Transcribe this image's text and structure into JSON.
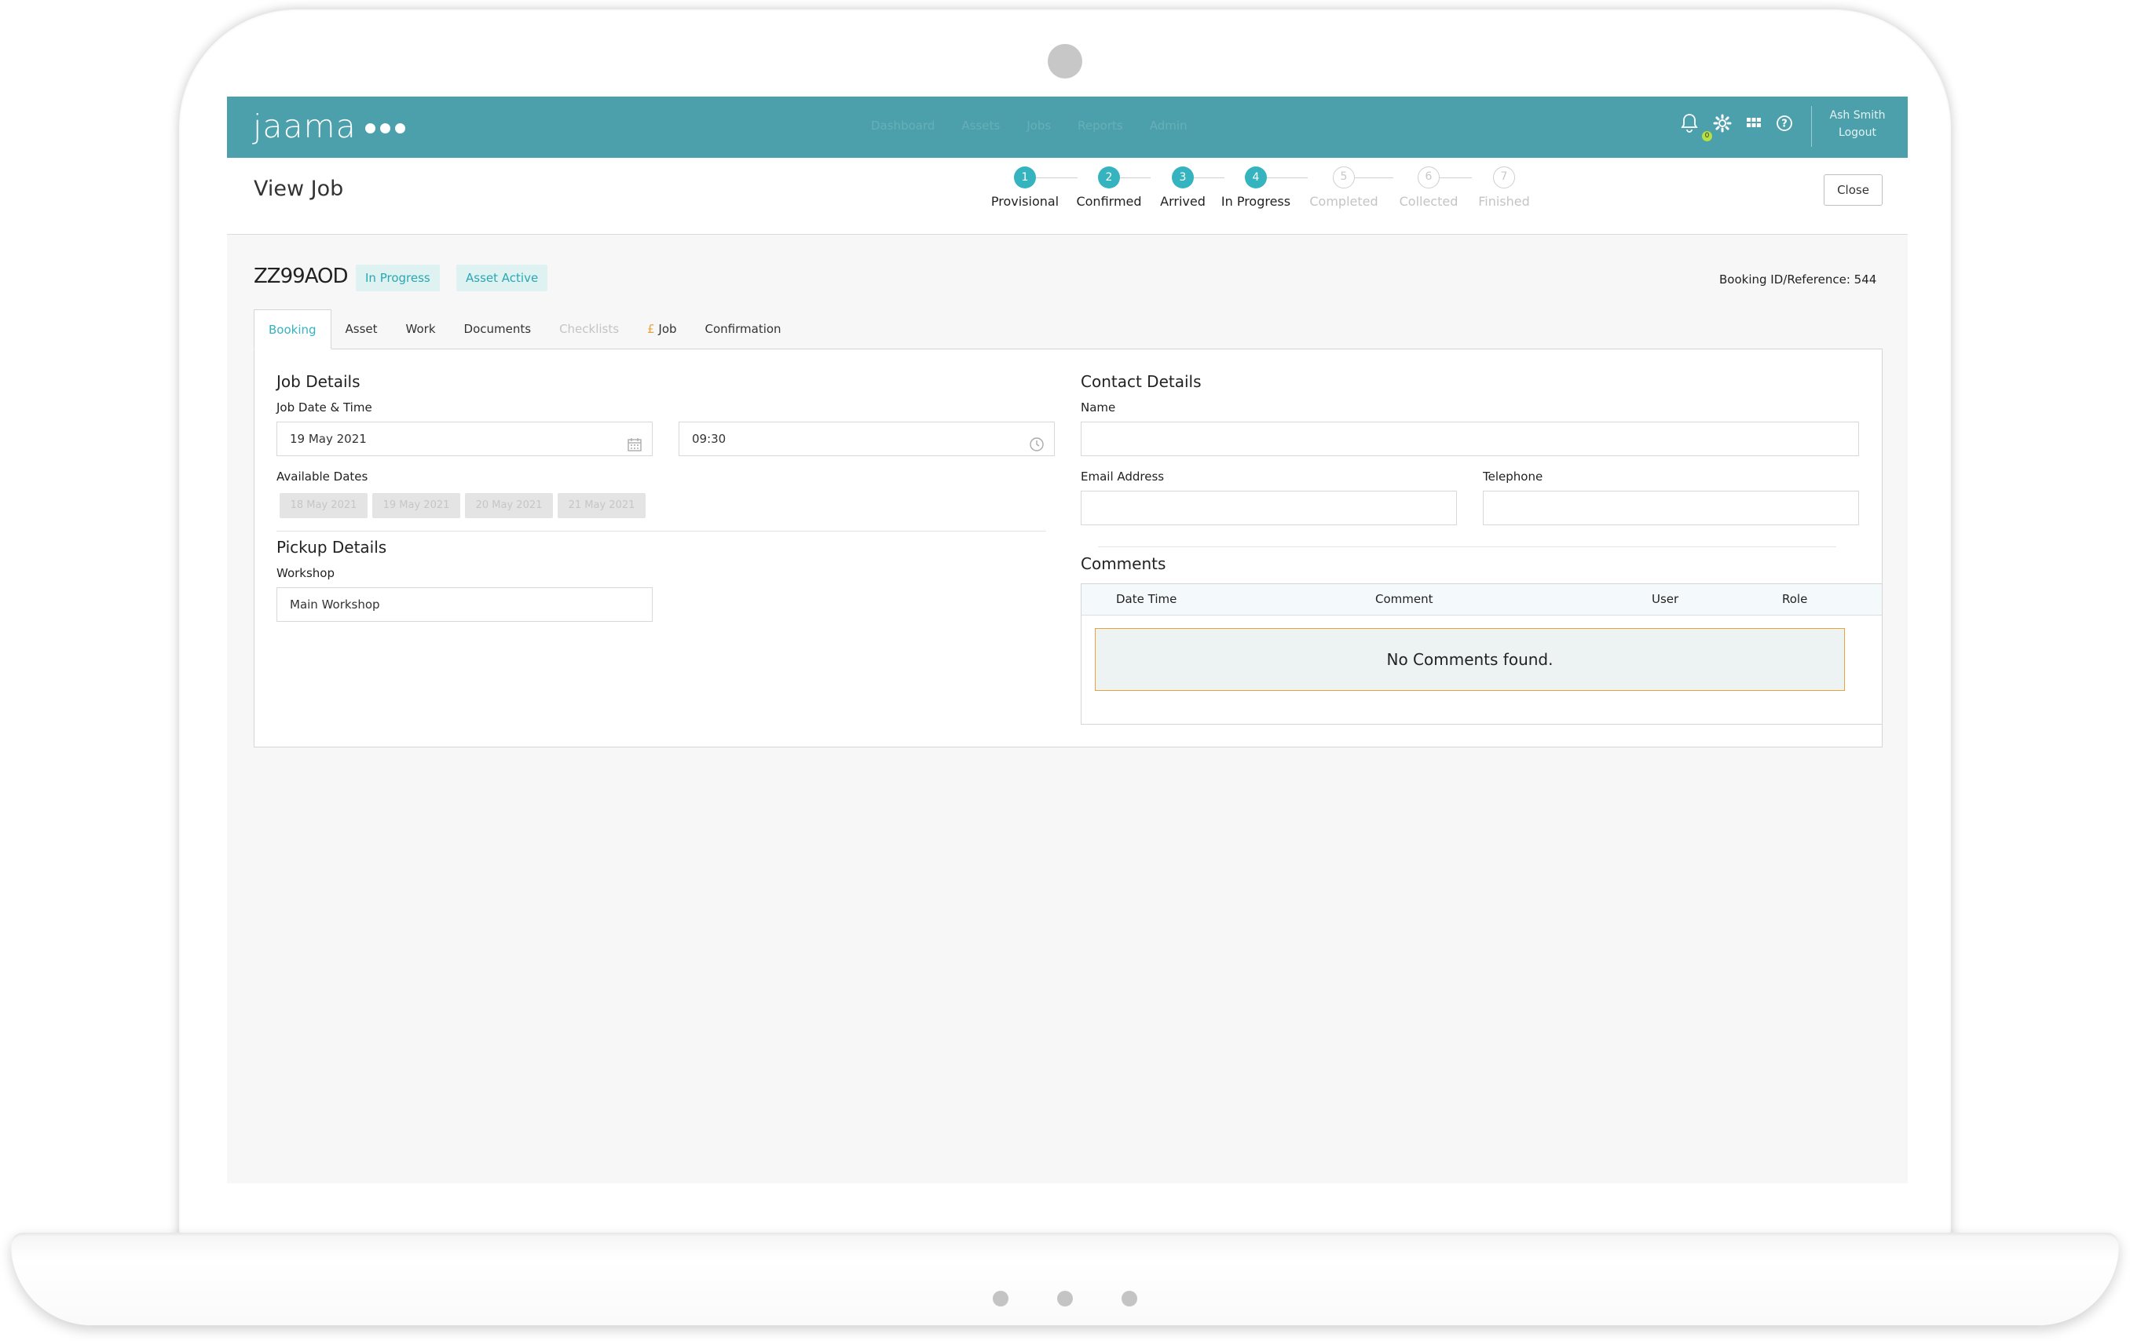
{
  "app": {
    "logo": "jaama",
    "nav_items": [
      "Dashboard",
      "Assets",
      "Jobs",
      "Reports",
      "Admin"
    ],
    "notifications_count": "0",
    "user_name": "Ash Smith",
    "logout_label": "Logout"
  },
  "page": {
    "title": "View Job",
    "close_label": "Close"
  },
  "stepper": {
    "steps": [
      {
        "number": "1",
        "label": "Provisional",
        "state": "complete"
      },
      {
        "number": "2",
        "label": "Confirmed",
        "state": "complete"
      },
      {
        "number": "3",
        "label": "Arrived",
        "state": "complete"
      },
      {
        "number": "4",
        "label": "In Progress",
        "state": "current"
      },
      {
        "number": "5",
        "label": "Completed",
        "state": "pending"
      },
      {
        "number": "6",
        "label": "Collected",
        "state": "pending"
      },
      {
        "number": "7",
        "label": "Finished",
        "state": "pending"
      }
    ]
  },
  "job": {
    "registration": "ZZ99AOD",
    "status_badge": "In Progress",
    "asset_badge": "Asset Active",
    "booking_ref": "Booking ID/Reference: 544"
  },
  "tabs": {
    "booking": "Booking",
    "asset": "Asset",
    "work": "Work",
    "documents": "Documents",
    "checklists": "Checklists",
    "job_pound": "£",
    "job": "Job",
    "confirmation": "Confirmation"
  },
  "job_details": {
    "title": "Job Details",
    "date_time_label": "Job Date & Time",
    "date_value": "19 May 2021",
    "time_value": "09:30",
    "available_dates_label": "Available Dates",
    "available_dates": [
      "18 May 2021",
      "19 May 2021",
      "20 May 2021",
      "21 May 2021"
    ]
  },
  "pickup": {
    "title": "Pickup Details",
    "workshop_label": "Workshop",
    "workshop_value": "Main Workshop"
  },
  "contact": {
    "title": "Contact Details",
    "name_label": "Name",
    "name_value": "",
    "email_label": "Email Address",
    "email_value": "",
    "telephone_label": "Telephone",
    "telephone_value": ""
  },
  "comments": {
    "title": "Comments",
    "columns": [
      "Date Time",
      "Comment",
      "User",
      "Role"
    ],
    "empty_message": "No Comments found."
  },
  "colors": {
    "topbar": "#4ba0ab",
    "accent": "#35b3bf",
    "badge_bg": "#dff2f2",
    "warning_border": "#eaa33a"
  }
}
